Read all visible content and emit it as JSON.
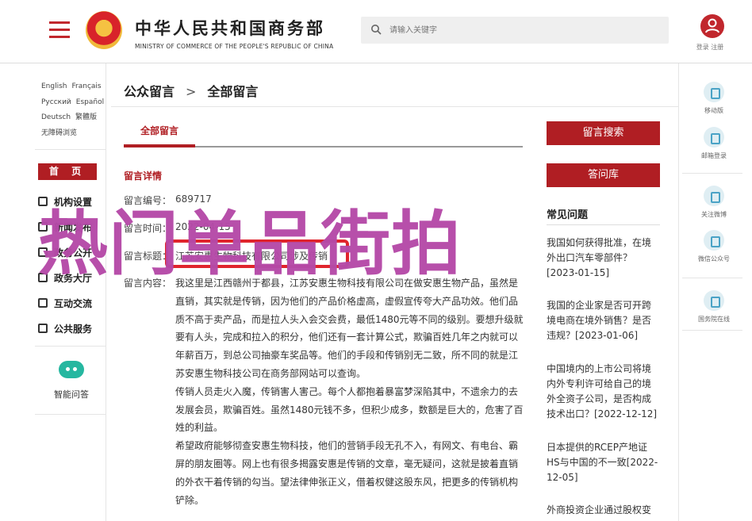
{
  "header": {
    "site_title_cn": "中华人民共和国商务部",
    "site_title_en": "MINISTRY OF COMMERCE OF THE PEOPLE'S REPUBLIC OF CHINA",
    "search_placeholder": "请输入关键字",
    "user_links": "登录  注册"
  },
  "languages": [
    "English",
    "Français",
    "Русский",
    "Español",
    "Deutsch",
    "繁體版",
    "无障碍浏览"
  ],
  "leftnav": {
    "home": "首 页",
    "items": [
      "机构设置",
      "新闻发布",
      "政务公开",
      "政务大厅",
      "互动交流",
      "公共服务"
    ],
    "smart_qa": "智能问答"
  },
  "breadcrumb": {
    "level1": "公众留言",
    "separator": ">",
    "level2": "全部留言"
  },
  "tab_active": "全部留言",
  "detail": {
    "section_title": "留言详情",
    "id_label": "留言编号：",
    "id_value": "689717",
    "time_label": "留言时间：",
    "time_value": "2022-04-15",
    "title_label": "留言标题：",
    "title_value": "江苏安惠生物科技有限公司涉及传销",
    "content_label": "留言内容：",
    "paragraphs": [
      "我这里是江西赣州于都县，江苏安惠生物科技有限公司在做安惠生物产品，虽然是直销，其实就是传销，因为他们的产品价格虚高，虚假宣传夸大产品功效。他们品质不高于卖产品，而是拉人头入会交会费，最低1480元等不同的级别。要想升级就要有人头，完成和拉入的积分，他们还有一套计算公式，欺骗百姓几年之内就可以年薪百万，到总公司抽豪车奖品等。他们的手段和传销别无二致，所不同的就是江苏安惠生物科技公司在商务部网站可以查询。",
      "传销人员走火入魔，传销害人害己。每个人都抱着暴富梦深陷其中，不遗余力的去发展会员，欺骗百姓。虽然1480元钱不多，但积少成多，数额是巨大的，危害了百姓的利益。",
      "希望政府能够彻查安惠生物科技，他们的营销手段无孔不入，有网文、有电台、霸屏的朋友圈等。网上也有很多揭露安惠是传销的文章，毫无疑问，这就是披着直销的外衣干着传销的勾当。望法律伸张正义，借着权健这股东风，把更多的传销机构铲除。"
    ]
  },
  "right": {
    "search_button": "留言搜索",
    "faq_button": "答问库",
    "faq_title": "常见问题",
    "faq_items": [
      "我国如何获得批准，在境外出口汽车零部件？[2023-01-15]",
      "我国的企业家是否可开跨境电商在境外销售？是否违规？[2023-01-06]",
      "中国境内的上市公司将境内外专利许可给自己的境外全资子公司，是否构成技术出口？[2022-12-12]",
      "日本提供的RCEP产地证HS与中国的不一致[2022-12-05]",
      "外商投资企业通过股权变"
    ]
  },
  "rightbar": {
    "items": [
      "移动版",
      "邮箱登录",
      "关注微博",
      "微信公众号",
      "国务院在线"
    ]
  },
  "watermark": "热门单品街拍"
}
